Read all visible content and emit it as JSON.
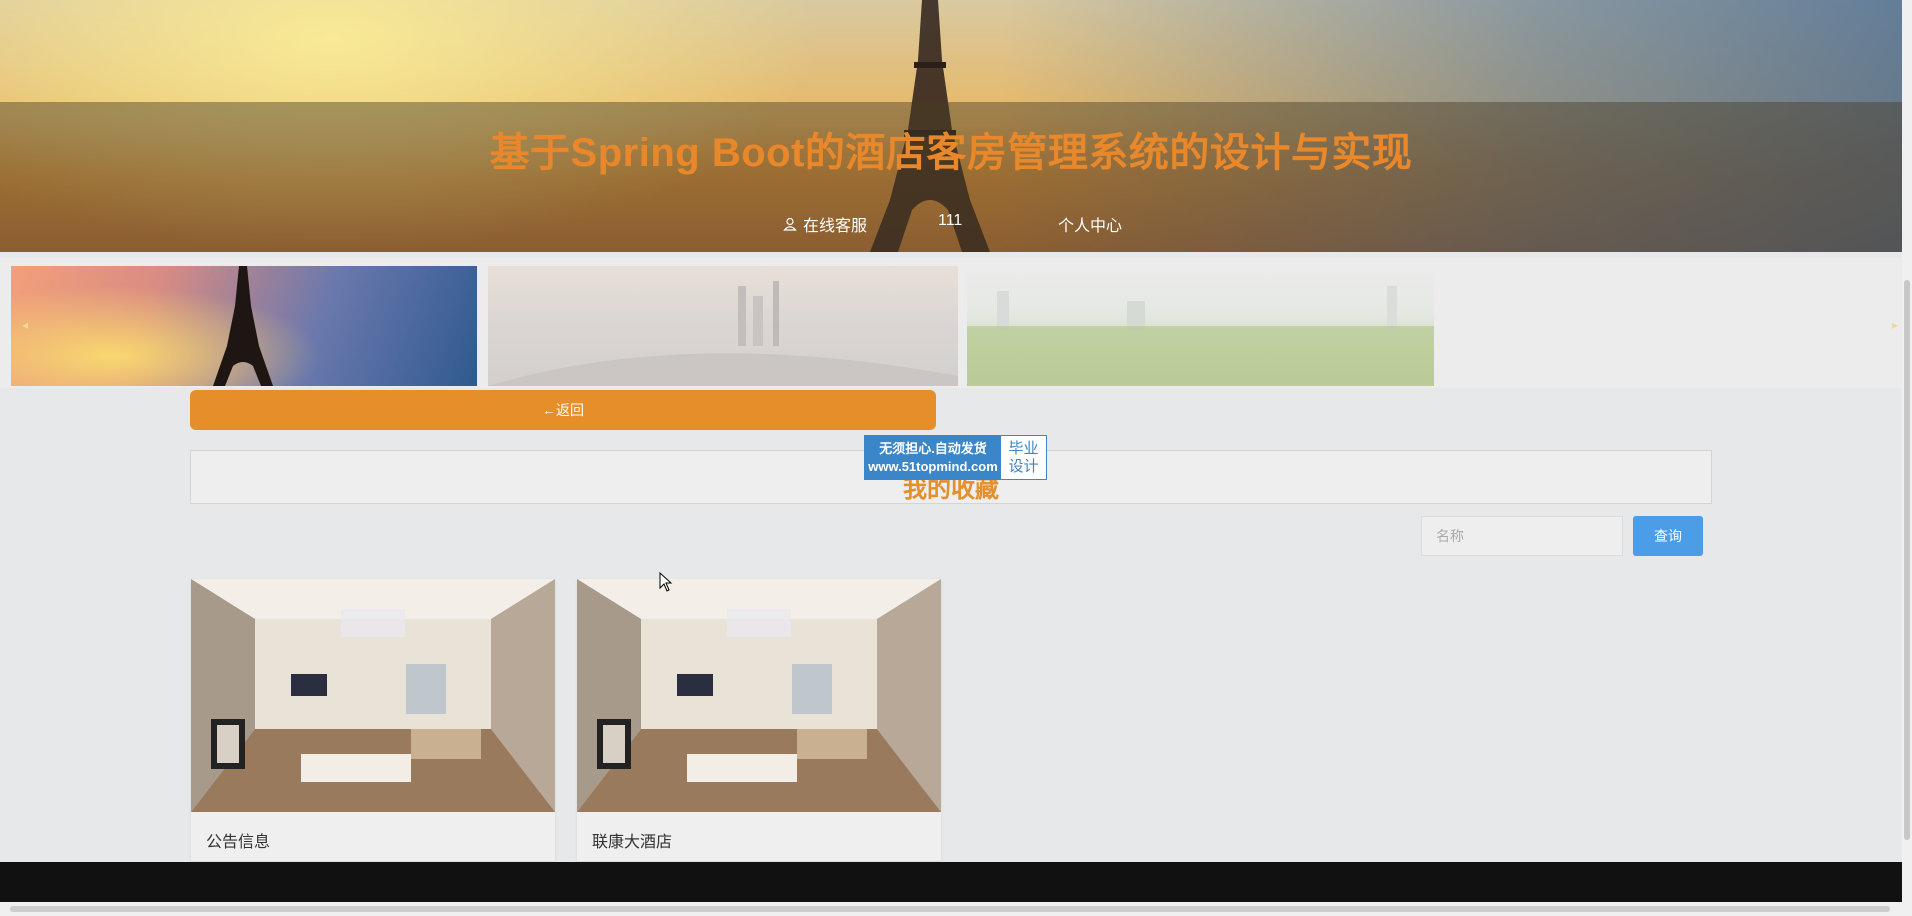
{
  "header": {
    "title": "基于Spring Boot的酒店客房管理系统的设计与实现",
    "nav": {
      "online_service": "在线客服",
      "user_number": "111",
      "personal_center": "个人中心"
    }
  },
  "carousel": {
    "prev_arrow": "◂",
    "next_arrow": "▸"
  },
  "main": {
    "back_label": "←返回",
    "section_title": "我的收藏",
    "search": {
      "placeholder": "名称",
      "button_label": "查询"
    },
    "cards": [
      {
        "label": "公告信息"
      },
      {
        "label": "联康大酒店"
      }
    ]
  },
  "watermark": {
    "line1": "无须担心.自动发货",
    "line2": "www.51topmind.com",
    "right_line1": "毕业",
    "right_line2": "设计"
  },
  "colors": {
    "accent": "#e58e2a",
    "button_blue": "#4a9de6",
    "footer": "#111111"
  }
}
